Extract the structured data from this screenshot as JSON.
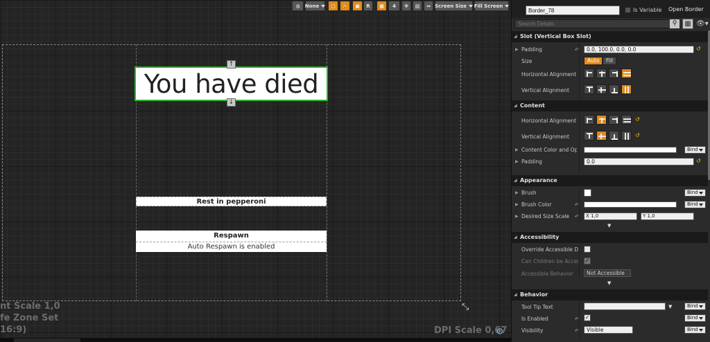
{
  "toolbar": {
    "preview_none": "None",
    "r_btn": "R",
    "grid_snap": "4",
    "screen_size": "Screen Size",
    "fill_screen": "Fill Screen"
  },
  "canvas": {
    "title": "You have died",
    "subtitle": "Rest in pepperoni",
    "respawn": "Respawn",
    "auto_respawn": "Auto Respawn is enabled",
    "handle_up": "↑",
    "handle_down": "↓"
  },
  "viewport_info": {
    "line1": "nt Scale 1,0",
    "line2": "fe Zone Set",
    "line3": "16:9)",
    "dpi": "DPI Scale 0,67"
  },
  "details": {
    "name_value": "Border_78",
    "is_variable": "Is Variable",
    "open_border": "Open Border",
    "search_placeholder": "Search Details",
    "sections": {
      "slot": "Slot (Vertical Box Slot)",
      "content": "Content",
      "appearance": "Appearance",
      "accessibility": "Accessibility",
      "behavior": "Behavior"
    },
    "slot": {
      "padding_label": "Padding",
      "padding_value": "0.0, 100.0, 0.0, 0.0",
      "size_label": "Size",
      "size_auto": "Auto",
      "size_fill": "Fill",
      "halign_label": "Horizontal Alignment",
      "valign_label": "Vertical Alignment"
    },
    "content": {
      "halign_label": "Horizontal Alignment",
      "valign_label": "Vertical Alignment",
      "color_label": "Content Color and Op",
      "padding_label": "Padding",
      "padding_value": "0.0"
    },
    "appearance": {
      "brush_label": "Brush",
      "brush_color_label": "Brush Color",
      "desired_size_label": "Desired Size Scale",
      "x_value": "X  1,0",
      "y_value": "Y  1,0"
    },
    "accessibility": {
      "override_label": "Override Accessible Defa",
      "can_children_label": "Can Children be Accessil",
      "behavior_label": "Accessible Behavior",
      "behavior_value": "Not Accessible"
    },
    "behavior": {
      "tooltip_label": "Tool Tip Text",
      "enabled_label": "Is Enabled",
      "visibility_label": "Visibility",
      "visibility_value": "Visible"
    },
    "bind_label": "Bind",
    "check_mark": "✓"
  }
}
